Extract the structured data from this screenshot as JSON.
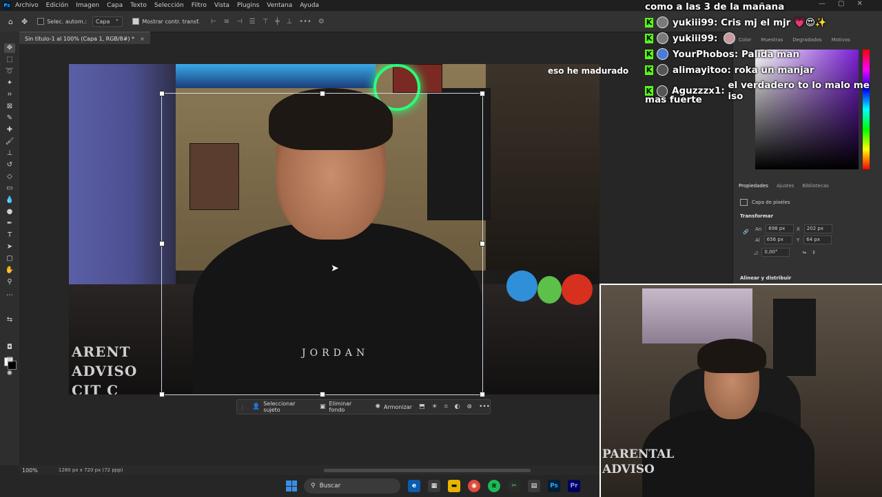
{
  "menubar": {
    "app_icon": "Ps",
    "items": [
      "Archivo",
      "Edición",
      "Imagen",
      "Capa",
      "Texto",
      "Selección",
      "Filtro",
      "Vista",
      "Plugins",
      "Ventana",
      "Ayuda"
    ]
  },
  "options": {
    "auto_select_label": "Selec. autom.:",
    "layer_select_value": "Capa",
    "show_transform_label": "Mostrar contr. transf."
  },
  "document": {
    "tab_title": "Sin título-1 al 100% (Capa 1, RGB/8#) *",
    "zoom": "100%",
    "info": "1280 px x 720 px (72 ppp)"
  },
  "context_bar": {
    "select_subject": "Seleccionar sujeto",
    "remove_background": "Eliminar fondo",
    "harmonize": "Armonizar"
  },
  "right_panel": {
    "top_tabs": [
      "Color",
      "Muestras",
      "Degradados",
      "Motivos"
    ],
    "tabs": [
      "Propiedades",
      "Ajustes",
      "Bibliotecas"
    ],
    "layer_type": "Capa de píxeles",
    "transform_title": "Transformar",
    "width_label": "An",
    "width": "698 px",
    "height_label": "Al",
    "height": "656 px",
    "x_label": "X",
    "x": "202 px",
    "y_label": "Y",
    "y": "64 px",
    "angle": "0,00°",
    "align_title": "Alinear y distribuir"
  },
  "stream": {
    "overlay_text": "eso he madurado",
    "shirt_text": "JORDAN",
    "rug_lines": [
      "ARENT",
      "ADVISO",
      "CIT C"
    ],
    "webcam_rug_lines": [
      "PARENTAL",
      "ADVISO"
    ]
  },
  "chat": {
    "top_line": "como a las 3 de la mañana",
    "messages": [
      {
        "user": "yukiii99:",
        "text": "Cris mj el mjr 💗😍✨"
      },
      {
        "user": "yukiii99:",
        "text": ""
      },
      {
        "user": "YourPhobos:",
        "text": "Palida man"
      },
      {
        "user": "alimayitoo:",
        "text": "roka un manjar"
      },
      {
        "user": "Aguzzzx1:",
        "text": "el verdadero to lo malo me iso"
      }
    ],
    "wrap_line": "mas fuerte"
  },
  "taskbar": {
    "search_label": "Buscar"
  },
  "colors": {
    "kick_green": "#53fc18",
    "ps_blue": "#31a8ff"
  }
}
